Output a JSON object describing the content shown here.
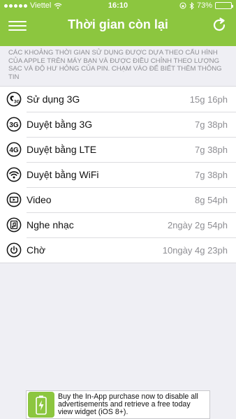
{
  "status_bar": {
    "carrier": "Viettel",
    "time": "16:10",
    "battery_percent": "73%",
    "battery_level": 0.73
  },
  "header": {
    "title": "Thời gian còn lại"
  },
  "info_text": "Các khoảng thời gian sử dụng được dựa theo cấu hình của Apple trên máy bạn và được điều chỉnh theo lượng sạc và độ hư hỏng của pin. Chạm vào để biết thêm thông tin",
  "rows": [
    {
      "icon": "call-3g-icon",
      "label": "Sử dụng 3G",
      "value": "15g 16ph"
    },
    {
      "icon": "3g-icon",
      "label": "Duyệt bằng 3G",
      "value": "7g 38ph"
    },
    {
      "icon": "4g-icon",
      "label": "Duyệt bằng LTE",
      "value": "7g 38ph"
    },
    {
      "icon": "wifi-icon",
      "label": "Duyệt bằng WiFi",
      "value": "7g 38ph"
    },
    {
      "icon": "video-icon",
      "label": "Video",
      "value": "8g 54ph"
    },
    {
      "icon": "music-icon",
      "label": "Nghe nhạc",
      "value": "2ngày 2g 54ph"
    },
    {
      "icon": "standby-icon",
      "label": "Chờ",
      "value": "10ngày 4g 23ph"
    }
  ],
  "ad": {
    "text": "Buy the In-App purchase now to disable all advertisements and retrieve a free today view widget (iOS 8+)."
  },
  "colors": {
    "accent": "#8cc63f",
    "background": "#efeff4"
  }
}
